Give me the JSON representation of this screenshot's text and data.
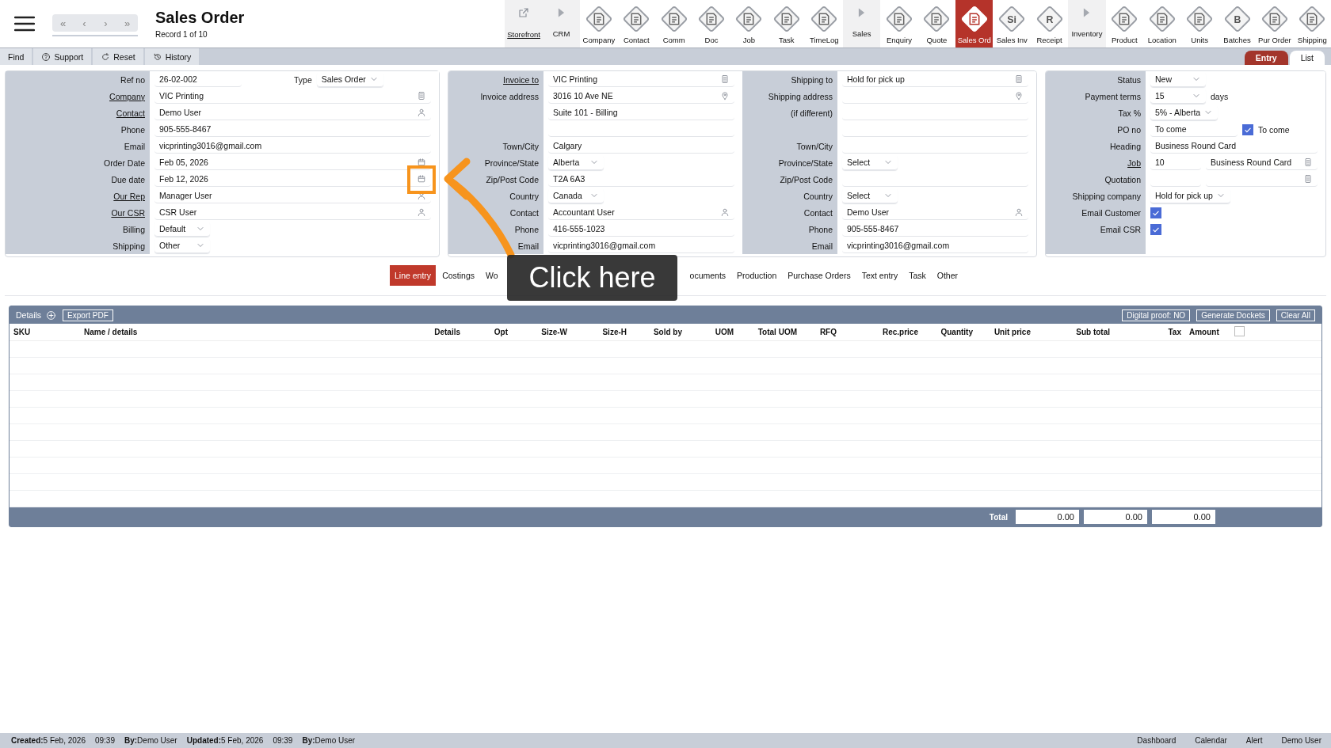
{
  "header": {
    "nav": [
      "«",
      "‹",
      "›",
      "»"
    ],
    "title": "Sales Order",
    "record": "Record 1 of 10"
  },
  "toolbar": [
    {
      "label": "Storefront",
      "kind": "link",
      "selected": false
    },
    {
      "label": "CRM",
      "kind": "section",
      "selected": false
    },
    {
      "label": "Company",
      "kind": "module",
      "selected": false
    },
    {
      "label": "Contact",
      "kind": "module",
      "selected": false
    },
    {
      "label": "Comm",
      "kind": "module",
      "selected": false
    },
    {
      "label": "Doc",
      "kind": "module",
      "selected": false
    },
    {
      "label": "Job",
      "kind": "module",
      "selected": false
    },
    {
      "label": "Task",
      "kind": "module",
      "selected": false
    },
    {
      "label": "TimeLog",
      "kind": "module",
      "selected": false
    },
    {
      "label": "Sales",
      "kind": "section",
      "selected": false
    },
    {
      "label": "Enquiry",
      "kind": "module",
      "selected": false
    },
    {
      "label": "Quote",
      "kind": "module",
      "selected": false
    },
    {
      "label": "Sales Ord",
      "kind": "module",
      "selected": true
    },
    {
      "label": "Sales Inv",
      "kind": "module",
      "glyph": "Si",
      "selected": false
    },
    {
      "label": "Receipt",
      "kind": "module",
      "glyph": "R",
      "selected": false
    },
    {
      "label": "Inventory",
      "kind": "section",
      "selected": false
    },
    {
      "label": "Product",
      "kind": "module",
      "selected": false
    },
    {
      "label": "Location",
      "kind": "module",
      "selected": false
    },
    {
      "label": "Units",
      "kind": "module",
      "selected": false
    },
    {
      "label": "Batches",
      "kind": "module",
      "glyph": "B",
      "selected": false
    },
    {
      "label": "Pur Order",
      "kind": "module",
      "selected": false
    },
    {
      "label": "Shipping",
      "kind": "module",
      "selected": false
    }
  ],
  "menu": [
    "Find",
    "Support",
    "Reset",
    "History"
  ],
  "view_tabs": [
    {
      "label": "Entry",
      "selected": true
    },
    {
      "label": "List",
      "selected": false
    }
  ],
  "form": [
    {
      "sections": [
        {
          "rows": [
            {
              "label": "Ref no",
              "link": false,
              "fields": [
                {
                  "kind": "text",
                  "value": "26-02-002"
                },
                {
                  "kind": "select",
                  "label": "Type",
                  "value": "Sales Order"
                }
              ]
            },
            {
              "label": "Company",
              "link": true,
              "fields": [
                {
                  "kind": "lookup",
                  "value": "VIC Printing"
                }
              ]
            },
            {
              "label": "Contact",
              "link": true,
              "fields": [
                {
                  "kind": "contact",
                  "value": "Demo User"
                }
              ]
            },
            {
              "label": "Phone",
              "link": false,
              "fields": [
                {
                  "kind": "text",
                  "value": "905-555-8467"
                }
              ]
            },
            {
              "label": "Email",
              "link": false,
              "fields": [
                {
                  "kind": "text",
                  "value": "vicprinting3016@gmail.com"
                }
              ]
            },
            {
              "label": "Order Date",
              "link": false,
              "fields": [
                {
                  "kind": "date",
                  "value": "Feb 05, 2026",
                  "highlighted": false
                }
              ]
            },
            {
              "label": "Due date",
              "link": false,
              "fields": [
                {
                  "kind": "date",
                  "value": "Feb 12, 2026",
                  "highlighted": true
                }
              ]
            },
            {
              "label": "Our Rep",
              "link": true,
              "fields": [
                {
                  "kind": "contact",
                  "value": "Manager User"
                }
              ]
            },
            {
              "label": "Our CSR",
              "link": true,
              "fields": [
                {
                  "kind": "contact",
                  "value": "CSR User"
                }
              ]
            },
            {
              "label": "Billing",
              "link": false,
              "fields": [
                {
                  "kind": "select",
                  "value": "Default"
                }
              ]
            },
            {
              "label": "Shipping",
              "link": false,
              "fields": [
                {
                  "kind": "select",
                  "value": "Other"
                }
              ]
            }
          ]
        }
      ]
    },
    {
      "sections": [
        {
          "rows": [
            {
              "label": "Invoice to",
              "link": true,
              "fields": [
                {
                  "kind": "lookup",
                  "value": "VIC Printing"
                }
              ]
            },
            {
              "label": "Invoice address",
              "link": false,
              "fields": [
                {
                  "kind": "address",
                  "value": "3016 10 Ave NE"
                }
              ]
            },
            {
              "fields": [
                {
                  "kind": "text",
                  "value": "Suite 101 - Billing"
                }
              ]
            },
            {
              "fields": [
                {
                  "kind": "text"
                }
              ]
            },
            {
              "label": "Town/City",
              "link": false,
              "fields": [
                {
                  "kind": "text",
                  "value": "Calgary"
                }
              ]
            },
            {
              "label": "Province/State",
              "link": false,
              "fields": [
                {
                  "kind": "select",
                  "value": "Alberta"
                }
              ]
            },
            {
              "label": "Zip/Post Code",
              "link": false,
              "fields": [
                {
                  "kind": "text",
                  "value": "T2A 6A3"
                }
              ]
            },
            {
              "label": "Country",
              "link": false,
              "fields": [
                {
                  "kind": "select",
                  "value": "Canada"
                }
              ]
            },
            {
              "label": "Contact",
              "link": false,
              "fields": [
                {
                  "kind": "contact",
                  "value": "Accountant User"
                }
              ]
            },
            {
              "label": "Phone",
              "link": false,
              "fields": [
                {
                  "kind": "text",
                  "value": "416-555-1023"
                }
              ]
            },
            {
              "label": "Email",
              "link": false,
              "fields": [
                {
                  "kind": "text",
                  "value": "vicprinting3016@gmail.com"
                }
              ]
            }
          ]
        },
        {
          "rows": [
            {
              "label": "Shipping to",
              "link": false,
              "fields": [
                {
                  "kind": "lookup",
                  "value": "Hold for pick up"
                }
              ]
            },
            {
              "label": "Shipping address",
              "link": false,
              "fields": [
                {
                  "kind": "address"
                }
              ]
            },
            {
              "label": "(if different)",
              "link": false,
              "fields": [
                {
                  "kind": "text"
                }
              ]
            },
            {
              "fields": [
                {
                  "kind": "text"
                }
              ]
            },
            {
              "label": "Town/City",
              "link": false,
              "fields": [
                {
                  "kind": "text"
                }
              ]
            },
            {
              "label": "Province/State",
              "link": false,
              "fields": [
                {
                  "kind": "select",
                  "value": "Select"
                }
              ]
            },
            {
              "label": "Zip/Post Code",
              "link": false,
              "fields": [
                {
                  "kind": "text"
                }
              ]
            },
            {
              "label": "Country",
              "link": false,
              "fields": [
                {
                  "kind": "select",
                  "value": "Select"
                }
              ]
            },
            {
              "label": "Contact",
              "link": false,
              "fields": [
                {
                  "kind": "contact",
                  "value": "Demo User"
                }
              ]
            },
            {
              "label": "Phone",
              "link": false,
              "fields": [
                {
                  "kind": "text",
                  "value": "905-555-8467"
                }
              ]
            },
            {
              "label": "Email",
              "link": false,
              "fields": [
                {
                  "kind": "text",
                  "value": "vicprinting3016@gmail.com"
                }
              ]
            }
          ]
        }
      ]
    },
    {
      "sections": [
        {
          "rows": [
            {
              "label": "Status",
              "link": false,
              "fields": [
                {
                  "kind": "select",
                  "value": "New"
                }
              ]
            },
            {
              "label": "Payment terms",
              "link": false,
              "fields": [
                {
                  "kind": "select",
                  "value": "15",
                  "suffix": "days"
                }
              ]
            },
            {
              "label": "Tax %",
              "link": false,
              "fields": [
                {
                  "kind": "select",
                  "value": "5% - Alberta"
                }
              ]
            },
            {
              "label": "PO no",
              "link": false,
              "fields": [
                {
                  "kind": "text",
                  "value": "To come"
                },
                {
                  "kind": "check",
                  "checked": true,
                  "caption": "To come"
                }
              ]
            },
            {
              "label": "Heading",
              "link": false,
              "fields": [
                {
                  "kind": "text",
                  "value": "Business Round Card"
                }
              ]
            },
            {
              "label": "Job",
              "link": true,
              "fields": [
                {
                  "kind": "text",
                  "value": "10"
                },
                {
                  "kind": "lookup",
                  "value": "Business Round Card"
                }
              ]
            },
            {
              "label": "Quotation",
              "link": false,
              "fields": [
                {
                  "kind": "text"
                },
                {
                  "kind": "lookup"
                }
              ]
            },
            {
              "label": "Shipping company",
              "link": false,
              "fields": [
                {
                  "kind": "select",
                  "value": "Hold for pick up"
                }
              ]
            },
            {
              "label": "Email Customer",
              "link": false,
              "fields": [
                {
                  "kind": "check",
                  "checked": true
                }
              ]
            },
            {
              "label": "Email CSR",
              "link": false,
              "fields": [
                {
                  "kind": "check",
                  "checked": true
                }
              ]
            }
          ]
        }
      ]
    }
  ],
  "detail_tabs": [
    {
      "label": "Line entry",
      "selected": true
    },
    {
      "label": "Costings",
      "selected": false
    },
    {
      "label": "Wo",
      "selected": false
    },
    {
      "label": "ocuments",
      "selected": false
    },
    {
      "label": "Production",
      "selected": false
    },
    {
      "label": "Purchase Orders",
      "selected": false
    },
    {
      "label": "Text entry",
      "selected": false
    },
    {
      "label": "Task",
      "selected": false
    },
    {
      "label": "Other",
      "selected": false
    }
  ],
  "details": {
    "title": "Details",
    "left_buttons": [
      "Export PDF"
    ],
    "right_buttons": [
      "Digital proof: NO",
      "Generate Dockets",
      "Clear All"
    ],
    "columns": [
      {
        "kind": "text",
        "label": "SKU"
      },
      {
        "kind": "text",
        "label": "Name / details"
      },
      {
        "kind": "text",
        "label": "Details"
      },
      {
        "kind": "text",
        "label": "Opt"
      },
      {
        "kind": "text",
        "label": "Size-W"
      },
      {
        "kind": "text",
        "label": "Size-H"
      },
      {
        "kind": "text",
        "label": "Sold by"
      },
      {
        "kind": "text",
        "label": "UOM"
      },
      {
        "kind": "text",
        "label": "Total UOM"
      },
      {
        "kind": "text",
        "label": "RFQ"
      },
      {
        "kind": "text",
        "label": "Rec.price"
      },
      {
        "kind": "text",
        "label": "Quantity"
      },
      {
        "kind": "text",
        "label": "Unit price"
      },
      {
        "kind": "text",
        "label": "Sub total"
      },
      {
        "kind": "text",
        "label": "Tax"
      },
      {
        "kind": "text",
        "label": "Amount"
      },
      {
        "kind": "check",
        "checked": false
      }
    ],
    "total_label": "Total",
    "totals": [
      "0.00",
      "0.00",
      "0.00"
    ]
  },
  "callout": {
    "text": "Click here"
  },
  "footer": {
    "meta": [
      {
        "label": "Created:",
        "value": "5 Feb, 2026"
      },
      {
        "value": "09:39"
      },
      {
        "label": "By:",
        "value": "Demo User"
      },
      {
        "label": "Updated:",
        "value": "5 Feb, 2026"
      },
      {
        "value": "09:39"
      },
      {
        "label": "By:",
        "value": "Demo User"
      }
    ],
    "links": [
      "Dashboard",
      "Calendar",
      "Alert",
      "Demo User"
    ]
  }
}
